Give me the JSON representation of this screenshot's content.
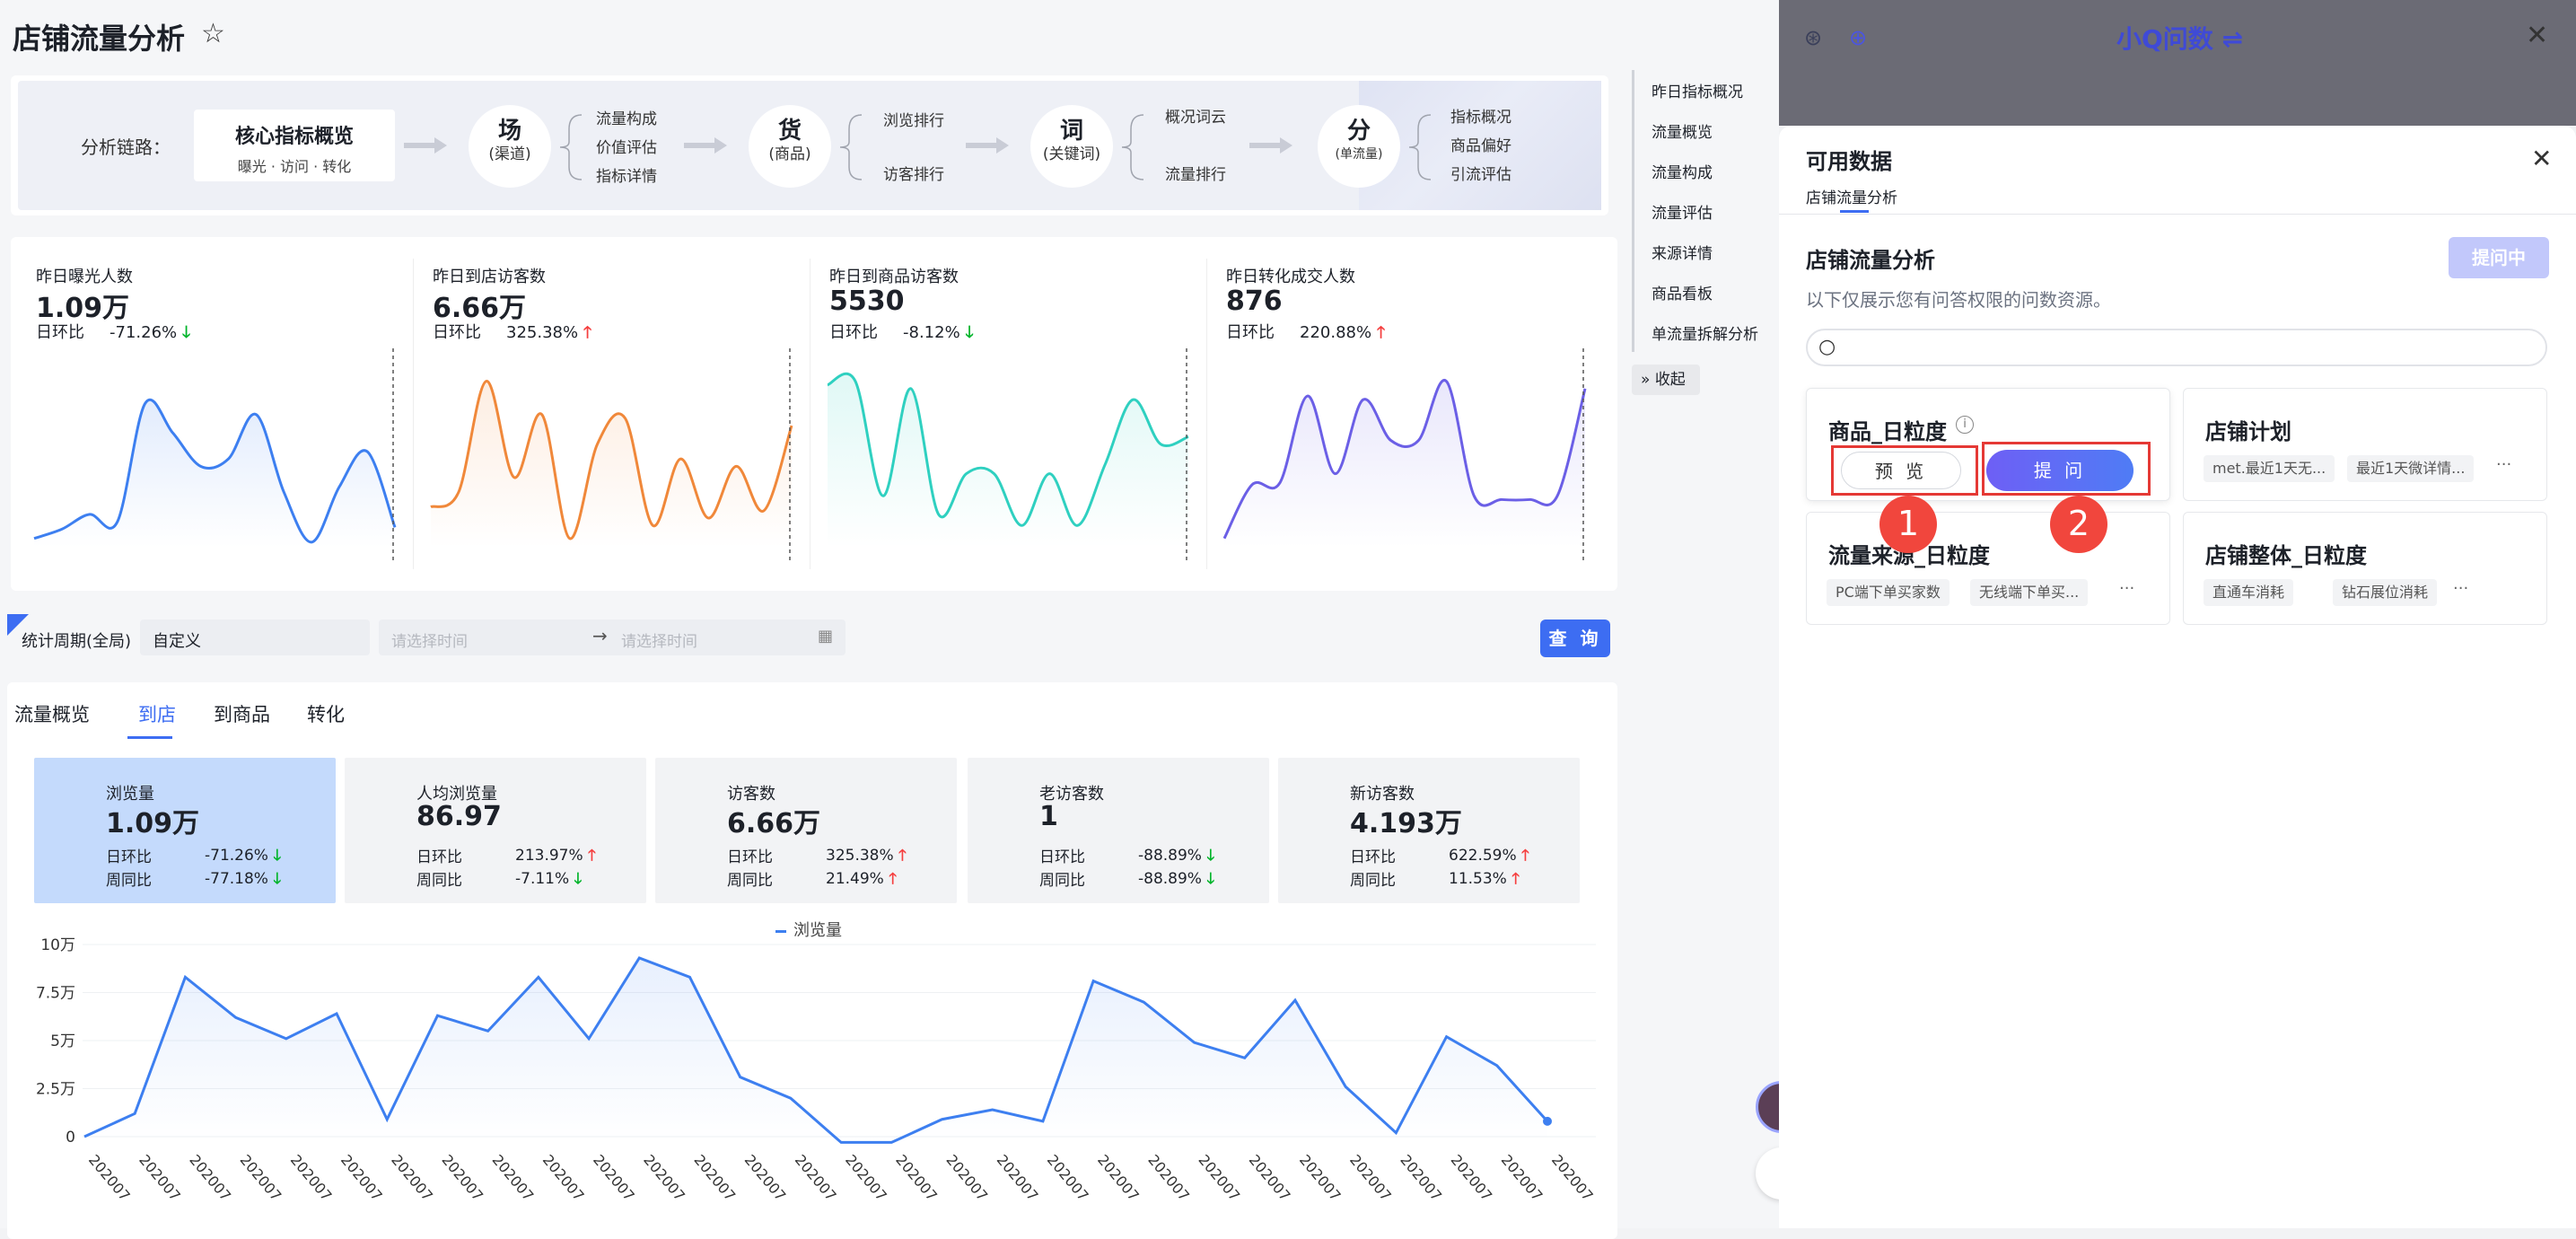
{
  "page": {
    "title": "店铺流量分析"
  },
  "chain": {
    "label": "分析链路：",
    "core": {
      "title": "核心指标概览",
      "sub": "曝光 · 访问 · 转化"
    },
    "nodes": [
      {
        "title": "场",
        "sub": "(渠道)",
        "items": [
          "流量构成",
          "价值评估",
          "指标详情"
        ]
      },
      {
        "title": "货",
        "sub": "(商品)",
        "items": [
          "浏览排行",
          "访客排行"
        ]
      },
      {
        "title": "词",
        "sub": "(关键词)",
        "items": [
          "概况词云",
          "流量排行"
        ]
      },
      {
        "title": "分",
        "sub": "(单流量)",
        "items": [
          "指标概况",
          "商品偏好",
          "引流评估"
        ]
      }
    ]
  },
  "kpis": [
    {
      "label": "昨日曝光人数",
      "value": "1.09万",
      "cmp_label": "日环比",
      "pct": "-71.26%",
      "trend": "down",
      "color": "#3d7ff0",
      "series": [
        5,
        10,
        18,
        14,
        78,
        62,
        44,
        48,
        72,
        30,
        3,
        33,
        52,
        11
      ]
    },
    {
      "label": "昨日到店访客数",
      "value": "6.66万",
      "cmp_label": "日环比",
      "pct": "325.38%",
      "trend": "up",
      "color": "#f0883a",
      "series": [
        22,
        30,
        90,
        38,
        72,
        5,
        56,
        70,
        12,
        48,
        16,
        44,
        20,
        66
      ]
    },
    {
      "label": "昨日到商品访客数",
      "value": "5530",
      "cmp_label": "日环比",
      "pct": "-8.12%",
      "trend": "down",
      "color": "#2fd0c0",
      "series": [
        88,
        90,
        28,
        86,
        18,
        40,
        40,
        12,
        40,
        12,
        45,
        80,
        56,
        60
      ]
    },
    {
      "label": "昨日转化成交人数",
      "value": "876",
      "cmp_label": "日环比",
      "pct": "220.88%",
      "trend": "up",
      "color": "#6b5fe6",
      "series": [
        5,
        34,
        35,
        82,
        40,
        80,
        58,
        58,
        90,
        28,
        26,
        26,
        28,
        86
      ]
    }
  ],
  "filter": {
    "label": "统计周期(全局)",
    "select": "自定义",
    "start_placeholder": "请选择时间",
    "end_placeholder": "请选择时间",
    "query": "查 询"
  },
  "tabs": [
    "流量概览",
    "到店",
    "到商品",
    "转化"
  ],
  "metrics": [
    {
      "label": "浏览量",
      "value": "1.09万",
      "rows": [
        {
          "k": "日环比",
          "v": "-71.26%",
          "trend": "down"
        },
        {
          "k": "周同比",
          "v": "-77.18%",
          "trend": "down"
        }
      ]
    },
    {
      "label": "人均浏览量",
      "value": "86.97",
      "rows": [
        {
          "k": "日环比",
          "v": "213.97%",
          "trend": "up"
        },
        {
          "k": "周同比",
          "v": "-7.11%",
          "trend": "down"
        }
      ]
    },
    {
      "label": "访客数",
      "value": "6.66万",
      "rows": [
        {
          "k": "日环比",
          "v": "325.38%",
          "trend": "up"
        },
        {
          "k": "周同比",
          "v": "21.49%",
          "trend": "up"
        }
      ]
    },
    {
      "label": "老访客数",
      "value": "1",
      "rows": [
        {
          "k": "日环比",
          "v": "-88.89%",
          "trend": "down"
        },
        {
          "k": "周同比",
          "v": "-88.89%",
          "trend": "down"
        }
      ]
    },
    {
      "label": "新访客数",
      "value": "4.193万",
      "rows": [
        {
          "k": "日环比",
          "v": "622.59%",
          "trend": "up"
        },
        {
          "k": "周同比",
          "v": "11.53%",
          "trend": "up"
        }
      ]
    }
  ],
  "chart_data": {
    "type": "line",
    "series": [
      {
        "name": "浏览量",
        "color": "#3d7ff0",
        "values": [
          0,
          1.2,
          8.3,
          6.2,
          5.1,
          6.4,
          0.9,
          6.3,
          5.5,
          8.3,
          5.1,
          9.3,
          8.3,
          3.1,
          2,
          -0.3,
          -0.3,
          0.9,
          1.4,
          0.8,
          8.1,
          7,
          4.9,
          4.1,
          7.1,
          2.6,
          0.2,
          5.2,
          3.7,
          0.8
        ]
      }
    ],
    "x": [
      "202007",
      "202007",
      "202007",
      "202007",
      "202007",
      "202007",
      "202007",
      "202007",
      "202007",
      "202007",
      "202007",
      "202007",
      "202007",
      "202007",
      "202007",
      "202007",
      "202007",
      "202007",
      "202007",
      "202007",
      "202007",
      "202007",
      "202007",
      "202007",
      "202007",
      "202007",
      "202007",
      "202007",
      "202007",
      "202007"
    ],
    "ytick_labels": [
      "0",
      "2.5万",
      "5万",
      "7.5万",
      "10万"
    ],
    "yticks": [
      0,
      2.5,
      5,
      7.5,
      10
    ],
    "ylim": [
      0,
      10
    ],
    "legend": "top-center"
  },
  "right_nav": {
    "items": [
      "昨日指标概况",
      "流量概览",
      "流量构成",
      "流量评估",
      "来源详情",
      "商品看板",
      "单流量拆解分析"
    ],
    "collapse": "收起"
  },
  "assistant": {
    "title": "小Q问数 ⇌",
    "panel_title": "可用数据",
    "tab": "店铺流量分析",
    "section": "店铺流量分析",
    "ask_status": "提问中",
    "desc": "以下仅展示您有问答权限的问数资源。",
    "cards": [
      {
        "name": "商品_日粒度",
        "preview": "预 览",
        "ask": "提 问"
      },
      {
        "name": "店铺计划",
        "tags": [
          "met.最近1天无...",
          "最近1天微详情..."
        ]
      },
      {
        "name": "流量来源_日粒度",
        "tags": [
          "PC端下单买家数",
          "无线端下单买..."
        ]
      },
      {
        "name": "店铺整体_日粒度",
        "tags": [
          "直通车消耗",
          "钻石展位消耗"
        ]
      }
    ],
    "badges": [
      "1",
      "2"
    ]
  }
}
